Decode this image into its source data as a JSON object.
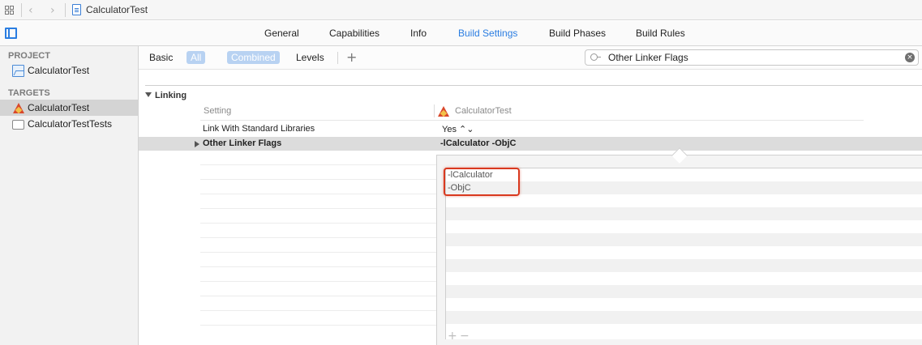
{
  "jumpbar": {
    "title": "CalculatorTest"
  },
  "tabs": [
    {
      "label": "General",
      "active": false
    },
    {
      "label": "Capabilities",
      "active": false
    },
    {
      "label": "Info",
      "active": false
    },
    {
      "label": "Build Settings",
      "active": true
    },
    {
      "label": "Build Phases",
      "active": false
    },
    {
      "label": "Build Rules",
      "active": false
    }
  ],
  "sidebar": {
    "project_header": "PROJECT",
    "project_item": "CalculatorTest",
    "targets_header": "TARGETS",
    "targets": [
      {
        "label": "CalculatorTest",
        "selected": true,
        "icon": "app-target-icon"
      },
      {
        "label": "CalculatorTestTests",
        "selected": false,
        "icon": "test-bundle-icon"
      }
    ]
  },
  "filter": {
    "basic": "Basic",
    "all": "All",
    "combined": "Combined",
    "levels": "Levels",
    "add": "+",
    "search_value": "Other Linker Flags"
  },
  "section": {
    "title": "Linking"
  },
  "columns": {
    "setting": "Setting",
    "target": "CalculatorTest"
  },
  "rows": [
    {
      "setting": "Link With Standard Libraries",
      "value": "Yes ⌃⌄"
    },
    {
      "setting": "Other Linker Flags",
      "value": "-lCalculator -ObjC"
    }
  ],
  "popover": {
    "items": [
      "-lCalculator",
      "-ObjC"
    ],
    "add_label": "+",
    "remove_label": "−"
  },
  "colors": {
    "accent": "#2a7de1",
    "highlight": "#d9391f"
  }
}
